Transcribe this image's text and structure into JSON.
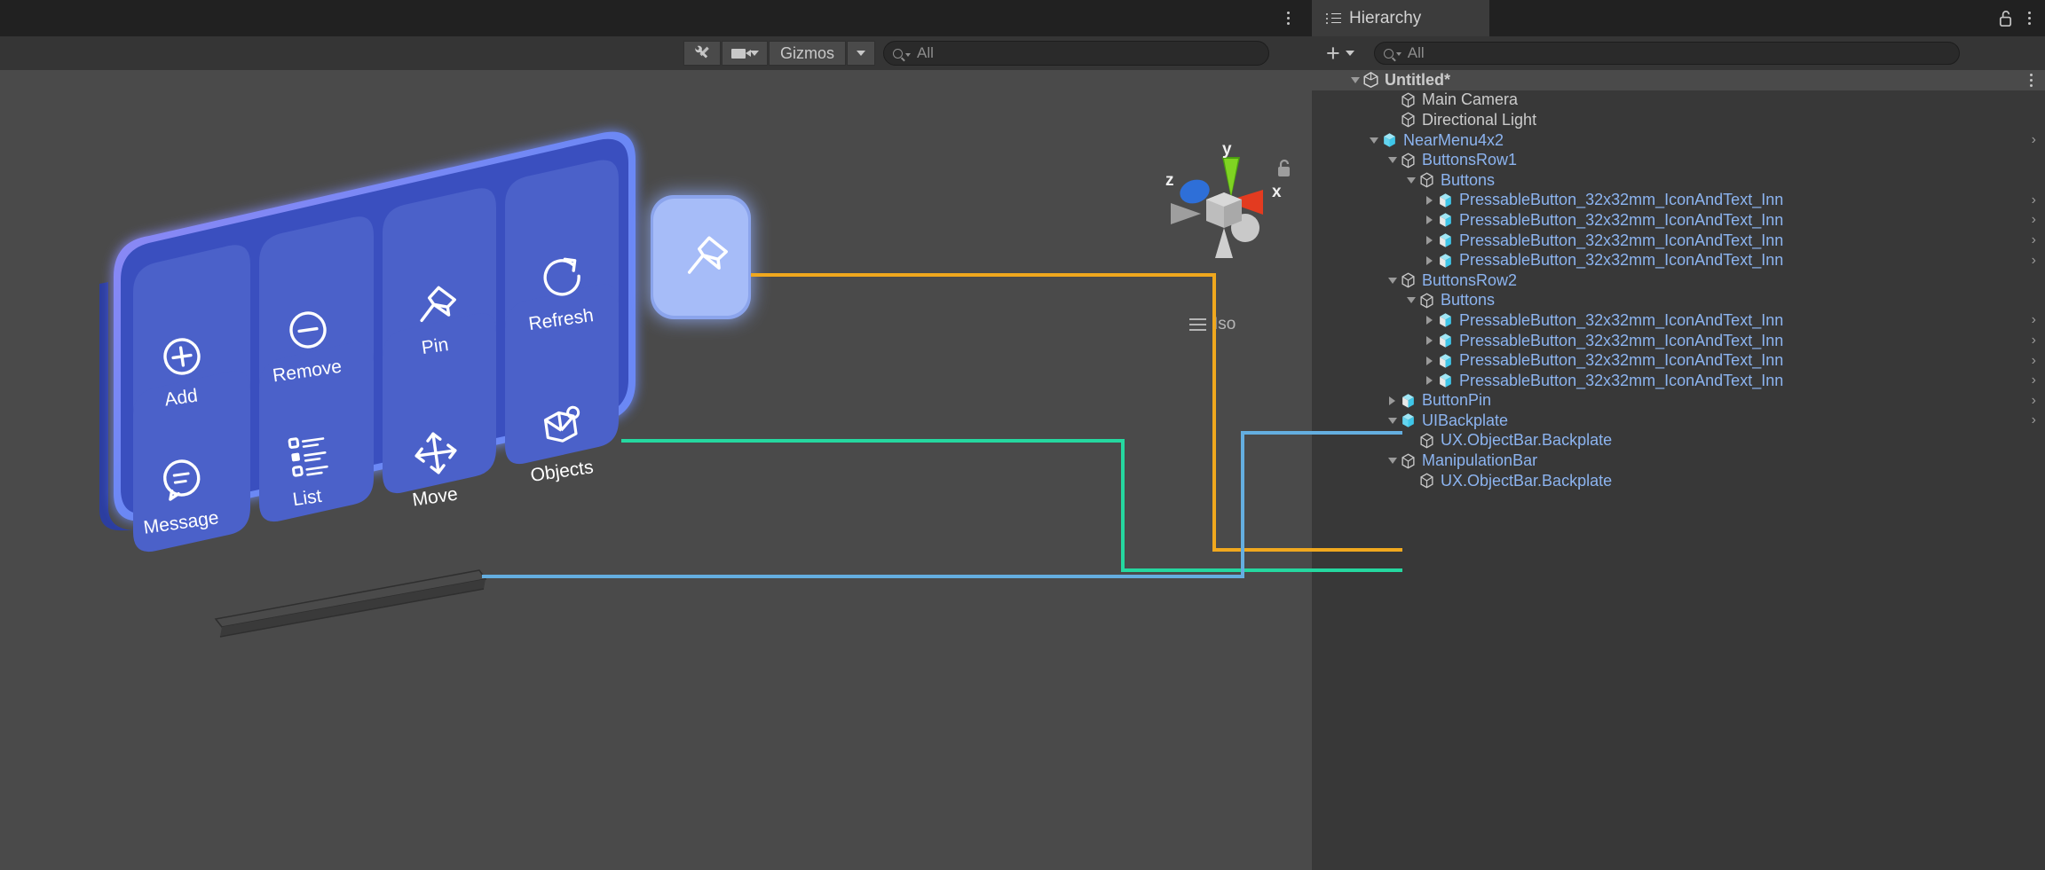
{
  "scene_panel": {
    "toolbar": {
      "tool_icon": "wrench-screwdriver-icon",
      "camera_icon": "camera-icon",
      "gizmos_label": "Gizmos",
      "search_placeholder": "All",
      "search_icon": "search-icon",
      "kebab_icon": "more-options-icon"
    },
    "gizmo": {
      "axis_x": "x",
      "axis_y": "y",
      "axis_z": "z",
      "projection_label": "Iso",
      "lock_icon": "unlocked-padlock-icon",
      "menu_icon": "hamburger-lines-icon",
      "colors": {
        "x": "#e33b20",
        "y": "#7fd322",
        "z": "#2e6fd8",
        "center": "#c9c9c9"
      }
    },
    "near_menu": {
      "name": "NearMenu4x2",
      "backplate_color": "#3a4fbf",
      "button_color": "#4b61c9",
      "glow_color": "#6d8cff",
      "rows": [
        {
          "buttons": [
            {
              "label": "Add",
              "icon": "circle-plus-icon"
            },
            {
              "label": "Remove",
              "icon": "circle-minus-icon"
            },
            {
              "label": "Pin",
              "icon": "pin-icon"
            },
            {
              "label": "Refresh",
              "icon": "refresh-arrow-icon"
            }
          ]
        },
        {
          "buttons": [
            {
              "label": "Message",
              "icon": "chat-bubble-icon"
            },
            {
              "label": "List",
              "icon": "bulleted-list-icon"
            },
            {
              "label": "Move",
              "icon": "move-arrows-icon"
            },
            {
              "label": "Objects",
              "icon": "cubes-icon"
            }
          ]
        }
      ]
    },
    "pin_button_3d": {
      "label": "ButtonPin",
      "icon": "pin-icon",
      "color": "#8fa9f5"
    },
    "manipulation_bar_3d": {
      "label": "ManipulationBar",
      "color": "#3a3a3a"
    }
  },
  "hierarchy_panel": {
    "tab_label": "Hierarchy",
    "tab_icon": "hierarchy-list-icon",
    "lock_icon": "unlocked-padlock-icon",
    "kebab_icon": "more-options-icon",
    "add_button_label": "+",
    "add_button_icon": "plus-icon",
    "search_placeholder": "All",
    "search_icon": "search-icon",
    "tree": [
      {
        "label": "Untitled*",
        "depth": 0,
        "twisty": "down",
        "icon": "unity-scene-icon",
        "color": "white",
        "selected": true,
        "kebab": true
      },
      {
        "label": "Main Camera",
        "depth": 2,
        "twisty": "none",
        "icon": "gameobject-icon",
        "color": "white"
      },
      {
        "label": "Directional Light",
        "depth": 2,
        "twisty": "none",
        "icon": "gameobject-icon",
        "color": "white"
      },
      {
        "label": "NearMenu4x2",
        "depth": 1,
        "twisty": "down",
        "icon": "prefab-icon",
        "color": "blue",
        "chevron": true
      },
      {
        "label": "ButtonsRow1",
        "depth": 2,
        "twisty": "down",
        "icon": "gameobject-icon",
        "color": "blue"
      },
      {
        "label": "Buttons",
        "depth": 3,
        "twisty": "down",
        "icon": "gameobject-icon",
        "color": "blue"
      },
      {
        "label": "PressableButton_32x32mm_IconAndText_Inn",
        "depth": 4,
        "twisty": "right",
        "icon": "prefab-variant-icon",
        "color": "blue",
        "chevron": true
      },
      {
        "label": "PressableButton_32x32mm_IconAndText_Inn",
        "depth": 4,
        "twisty": "right",
        "icon": "prefab-variant-icon",
        "color": "blue",
        "chevron": true
      },
      {
        "label": "PressableButton_32x32mm_IconAndText_Inn",
        "depth": 4,
        "twisty": "right",
        "icon": "prefab-variant-icon",
        "color": "blue",
        "chevron": true
      },
      {
        "label": "PressableButton_32x32mm_IconAndText_Inn",
        "depth": 4,
        "twisty": "right",
        "icon": "prefab-variant-icon",
        "color": "blue",
        "chevron": true
      },
      {
        "label": "ButtonsRow2",
        "depth": 2,
        "twisty": "down",
        "icon": "gameobject-icon",
        "color": "blue"
      },
      {
        "label": "Buttons",
        "depth": 3,
        "twisty": "down",
        "icon": "gameobject-icon",
        "color": "blue"
      },
      {
        "label": "PressableButton_32x32mm_IconAndText_Inn",
        "depth": 4,
        "twisty": "right",
        "icon": "prefab-variant-icon",
        "color": "blue",
        "chevron": true
      },
      {
        "label": "PressableButton_32x32mm_IconAndText_Inn",
        "depth": 4,
        "twisty": "right",
        "icon": "prefab-variant-icon",
        "color": "blue",
        "chevron": true
      },
      {
        "label": "PressableButton_32x32mm_IconAndText_Inn",
        "depth": 4,
        "twisty": "right",
        "icon": "prefab-variant-icon",
        "color": "blue",
        "chevron": true
      },
      {
        "label": "PressableButton_32x32mm_IconAndText_Inn",
        "depth": 4,
        "twisty": "right",
        "icon": "prefab-variant-icon",
        "color": "blue",
        "chevron": true
      },
      {
        "label": "ButtonPin",
        "depth": 2,
        "twisty": "right",
        "icon": "prefab-variant-icon",
        "color": "blue",
        "chevron": true
      },
      {
        "label": "UIBackplate",
        "depth": 2,
        "twisty": "down",
        "icon": "prefab-icon",
        "color": "blue",
        "chevron": true
      },
      {
        "label": "UX.ObjectBar.Backplate",
        "depth": 3,
        "twisty": "none",
        "icon": "gameobject-icon",
        "color": "blue"
      },
      {
        "label": "ManipulationBar",
        "depth": 2,
        "twisty": "down",
        "icon": "gameobject-icon",
        "color": "blue"
      },
      {
        "label": "UX.ObjectBar.Backplate",
        "depth": 3,
        "twisty": "none",
        "icon": "gameobject-icon",
        "color": "blue"
      }
    ]
  },
  "connectors": [
    {
      "name": "pin-connector",
      "color": "#f0a81e",
      "target_row": "ButtonPin"
    },
    {
      "name": "backplate-connector",
      "color": "#25d8a0",
      "target_row": "UIBackplate"
    },
    {
      "name": "manipulationbar-connector",
      "color": "#64aee0",
      "target_row": "ManipulationBar"
    }
  ]
}
